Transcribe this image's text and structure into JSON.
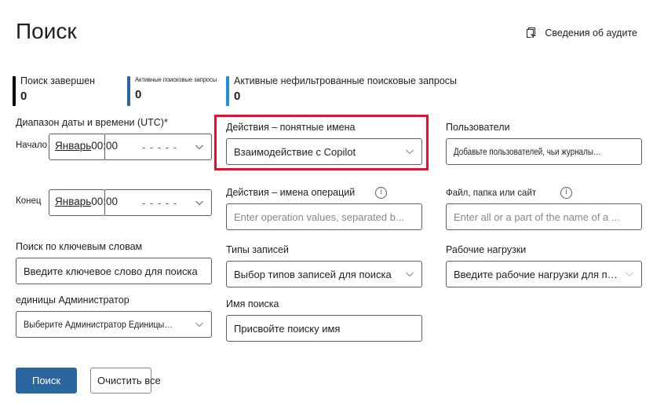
{
  "header": {
    "title": "Поиск",
    "audit_details_label": "Сведения об аудите",
    "audit_details_icon": "copy-pages-icon"
  },
  "stats": [
    {
      "label": "Поиск завершен",
      "value": "0",
      "bar_color": "#000000"
    },
    {
      "label": "Активные поисковые запросы",
      "value": "0",
      "bar_color": "#2b679f"
    },
    {
      "label": "Активные нефильтрованные поисковые запросы",
      "value": "0",
      "bar_color": "#1a8fe3"
    }
  ],
  "form": {
    "date_range": {
      "label": "Диапазон даты и времени (UTC)",
      "required_mark": "*",
      "start": {
        "side_label": "Начало",
        "date_value": "Январь",
        "date_value_suffix": "00:00",
        "time_value": "- - - - -",
        "chevron_icon": "chevron-down-icon"
      },
      "end": {
        "side_label": "Конец",
        "date_value": "Январь",
        "date_value_suffix": "00:00",
        "time_value": "- - - - -",
        "chevron_icon": "chevron-down-icon"
      }
    },
    "keyword_search": {
      "label": "Поиск по ключевым словам",
      "placeholder": "Введите ключевое слово для поиска"
    },
    "admin_units": {
      "label": "единицы Администратор",
      "placeholder": "Выберите Администратор  Единицы в.",
      "chevron_icon": "chevron-down-icon"
    },
    "activities_friendly": {
      "label": "Действия – понятные имена",
      "value": "Взаимодействие с Copilot",
      "chevron_icon": "chevron-down-icon"
    },
    "activities_operations": {
      "label": "Действия – имена операций",
      "info_icon": "info-circle-icon",
      "info_glyph": "i",
      "placeholder": "Enter operation values, separated b..."
    },
    "record_types": {
      "label": "Типы записей",
      "placeholder": "Выбор типов записей для поиска",
      "chevron_icon": "chevron-down-icon"
    },
    "search_name": {
      "label": "Имя поиска",
      "placeholder": "Присвойте поиску имя"
    },
    "users": {
      "label": "Пользователи",
      "placeholder": "Добавьте пользователей, чьи журналы аудита вы."
    },
    "file_folder_site": {
      "label": "Файл, папка или сайт",
      "info_icon": "info-circle-icon",
      "info_glyph": "i",
      "placeholder": "Enter all or a part of the name of a ..."
    },
    "workloads": {
      "label": "Рабочие нагрузки",
      "placeholder": "Введите рабочие нагрузки для поиска",
      "chevron_icon": "chevron-down-icon"
    }
  },
  "buttons": {
    "search": "Поиск",
    "clear_all": "Очистить все"
  },
  "highlight": {
    "color": "#e8112d",
    "target": "activities_friendly"
  }
}
